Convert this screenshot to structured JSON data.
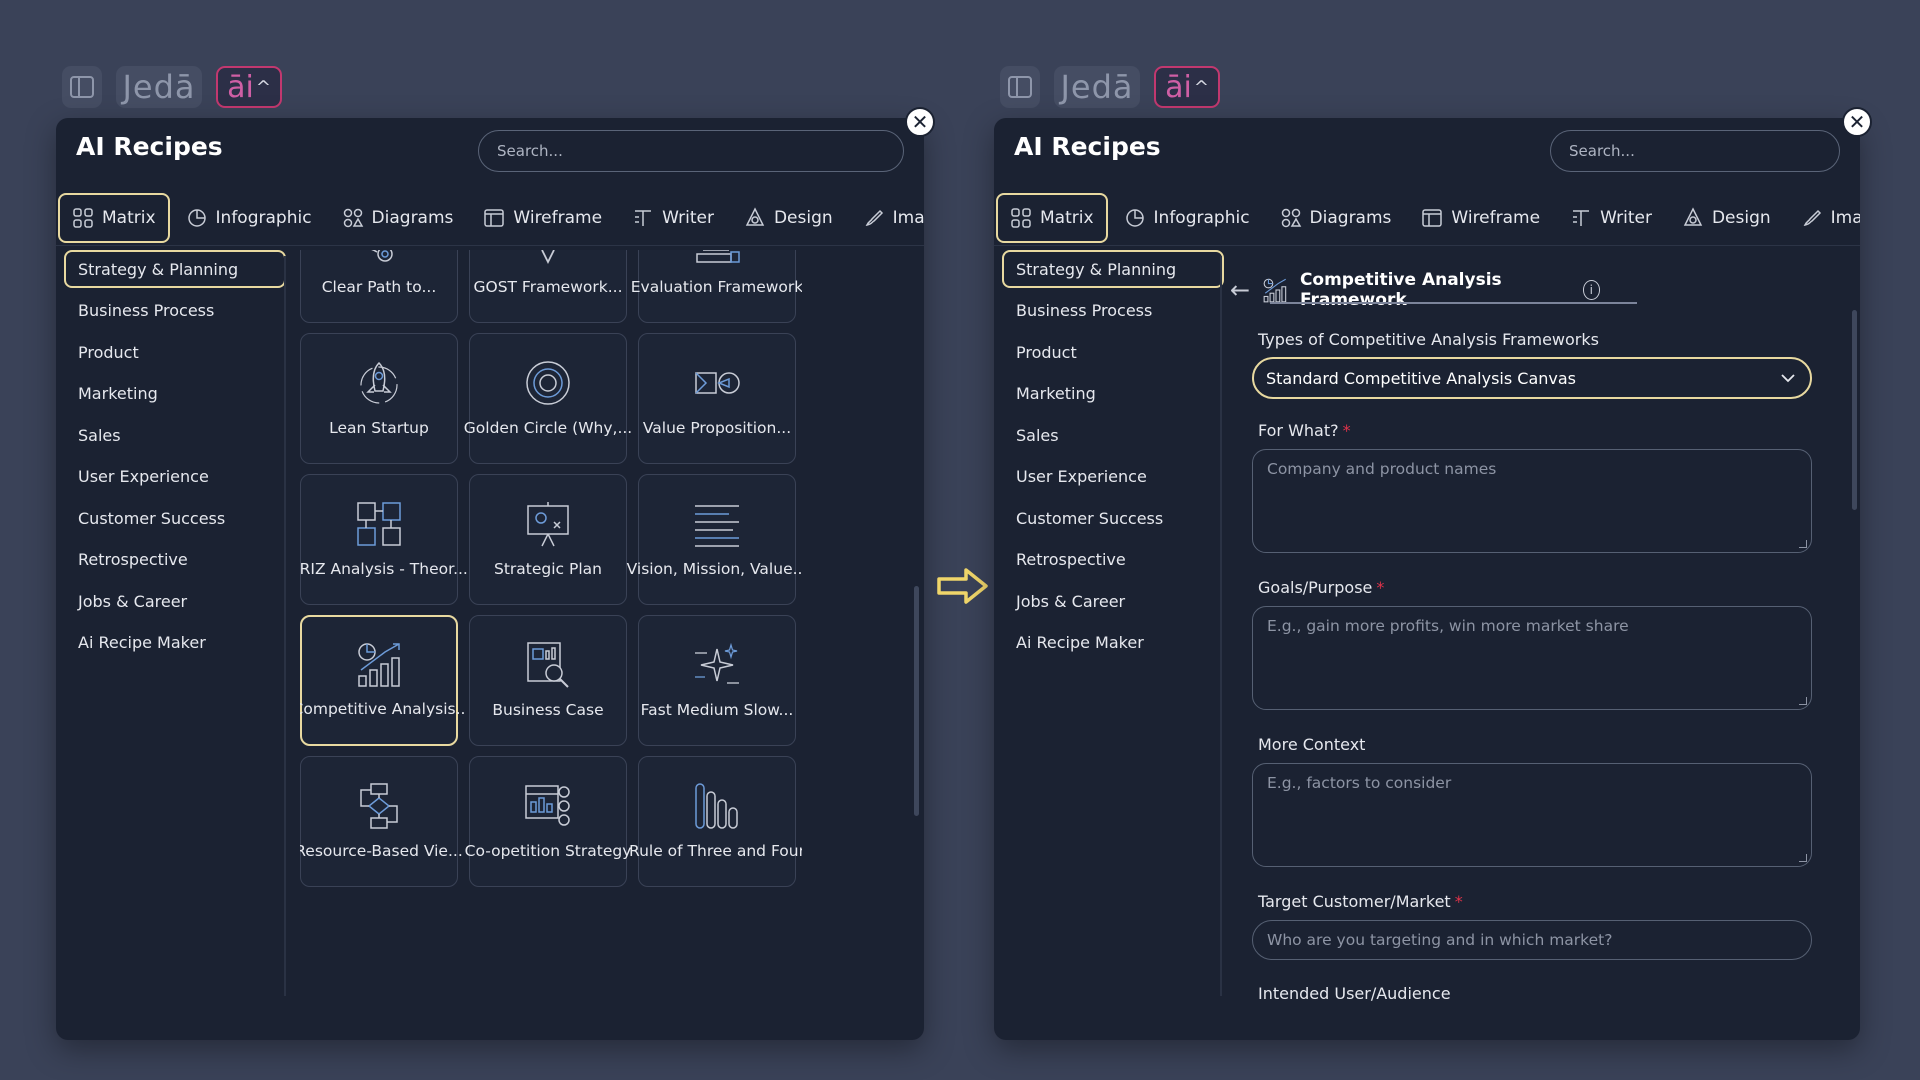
{
  "left": {
    "topbar": {
      "brand": "Jedā",
      "ai_label": "āi",
      "ai_caret": "^"
    },
    "title": "AI Recipes",
    "search_placeholder": "Search...",
    "tabs": [
      "Matrix",
      "Infographic",
      "Diagrams",
      "Wireframe",
      "Writer",
      "Design",
      "Image"
    ],
    "active_tab": "Matrix",
    "sidebar": [
      "Strategy & Planning",
      "Business Process",
      "Product",
      "Marketing",
      "Sales",
      "User Experience",
      "Customer Success",
      "Retrospective",
      "Jobs & Career",
      "Ai Recipe Maker"
    ],
    "active_category": "Strategy & Planning",
    "cards": [
      {
        "label": "Clear Path to...",
        "icon": "target-path-icon"
      },
      {
        "label": "GOST Framework...",
        "icon": "funnel-icon"
      },
      {
        "label": "Evaluation Framework",
        "icon": "evaluation-icon"
      },
      {
        "label": "Lean Startup",
        "icon": "rocket-icon"
      },
      {
        "label": "Golden Circle (Why,...",
        "icon": "concentric-circles-icon"
      },
      {
        "label": "Value Proposition...",
        "icon": "value-proposition-icon"
      },
      {
        "label": "TRIZ Analysis - Theor...",
        "icon": "triz-grid-icon"
      },
      {
        "label": "Strategic Plan",
        "icon": "presentation-board-icon"
      },
      {
        "label": "Vision, Mission, Value...",
        "icon": "text-lines-icon"
      },
      {
        "label": "Competitive Analysis..",
        "icon": "growth-chart-icon"
      },
      {
        "label": "Business Case",
        "icon": "document-magnifier-icon"
      },
      {
        "label": "Fast Medium Slow...",
        "icon": "sparkles-icon"
      },
      {
        "label": "Resource-Based Vie...",
        "icon": "flowchart-icon"
      },
      {
        "label": "Co-opetition Strategy",
        "icon": "team-board-icon"
      },
      {
        "label": "Rule of Three and Four",
        "icon": "bar-columns-icon"
      }
    ],
    "selected_card": "Competitive Analysis.."
  },
  "right": {
    "topbar": {
      "brand": "Jedā",
      "ai_label": "āi",
      "ai_caret": "^"
    },
    "title": "AI Recipes",
    "search_placeholder": "Search...",
    "tabs": [
      "Matrix",
      "Infographic",
      "Diagrams",
      "Wireframe",
      "Writer",
      "Design",
      "Image"
    ],
    "sidebar": [
      "Strategy & Planning",
      "Business Process",
      "Product",
      "Marketing",
      "Sales",
      "User Experience",
      "Customer Success",
      "Retrospective",
      "Jobs & Career",
      "Ai Recipe Maker"
    ],
    "form": {
      "back": "←",
      "title": "Competitive Analysis Framework",
      "info": "i",
      "type_label": "Types of Competitive Analysis Frameworks",
      "type_value": "Standard Competitive Analysis Canvas",
      "for_what_label": "For What?",
      "for_what_placeholder": "Company and product names",
      "goals_label": "Goals/Purpose",
      "goals_placeholder": "E.g., gain more profits, win more market share",
      "context_label": "More Context",
      "context_placeholder": "E.g., factors to consider",
      "target_label": "Target Customer/Market",
      "target_placeholder": "Who are you targeting and in which market?",
      "audience_label": "Intended User/Audience",
      "required_mark": "*"
    }
  },
  "colors": {
    "background": "#3a4258",
    "panel": "#1b2232",
    "highlight": "#e8d9a0",
    "ai_border": "#c2386f",
    "required": "#e0334a"
  }
}
